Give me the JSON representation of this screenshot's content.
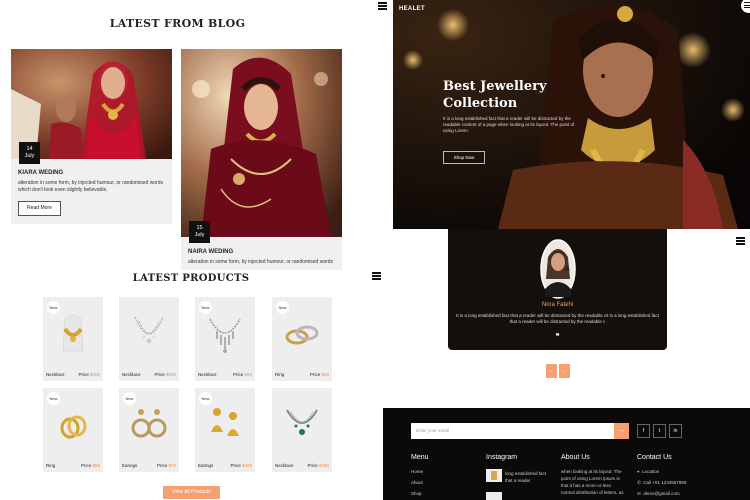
{
  "blog": {
    "title": "LATEST FROM BLOG",
    "posts": [
      {
        "day": "14",
        "month": "July",
        "title": "KIARA WEDING",
        "excerpt": "alteration in some form, by injected humour, or randomised words which don't look even slightly believable.",
        "read_more": "Read More"
      },
      {
        "day": "15",
        "month": "July",
        "title": "NAIRA WEDING",
        "excerpt": "alteration in some form, by injected humour, or randomised words"
      }
    ]
  },
  "products": {
    "title": "LATEST PRODUCTS",
    "badge": "New",
    "price_label": "Price",
    "items": [
      {
        "badge": "New",
        "name": "Necklace",
        "price": "$200",
        "icon": "gold-choker-icon"
      },
      {
        "badge": "",
        "name": "Necklace",
        "price": "$300",
        "icon": "diamond-necklace-icon"
      },
      {
        "badge": "New",
        "name": "Necklace",
        "price": "$90",
        "icon": "silver-necklace-icon"
      },
      {
        "badge": "New",
        "name": "Ring",
        "price": "$49",
        "icon": "ring-pair-icon"
      },
      {
        "badge": "New",
        "name": "Ring",
        "price": "$50",
        "icon": "gold-ring-icon"
      },
      {
        "badge": "New",
        "name": "Earings",
        "price": "$72",
        "icon": "pearl-earring-icon"
      },
      {
        "badge": "New",
        "name": "Earings",
        "price": "$480",
        "icon": "gold-jhumka-icon"
      },
      {
        "badge": "",
        "name": "Necklace",
        "price": "$490",
        "icon": "emerald-necklace-icon"
      }
    ],
    "view_all": "View All Products"
  },
  "hero": {
    "logo": "HEALET",
    "title_line1": "Best Jewellery",
    "title_line2": "Collection",
    "text": "It is a long established fact that a reader will be distracted by the readable content of a page when looking at its layout. The point of using Lorem",
    "button": "Shop Now"
  },
  "testimonial": {
    "name": "Nora Fatehi",
    "quote": "It is a long established fact that a reader will be distracted by the readable cit is a long established fact that a reader will be distracted by the readable c",
    "mark": "❝"
  },
  "slider": {
    "prev": "←",
    "next": "→"
  },
  "footer": {
    "email_placeholder": "Enter your email",
    "email_submit": "→",
    "social": [
      "f",
      "t",
      "in"
    ],
    "menu_title": "Menu",
    "menu": [
      "Home",
      "About",
      "Shop"
    ],
    "instagram_title": "Instagram",
    "instagram_text": "long established fact that a reader",
    "about_title": "About Us",
    "about_text": [
      "when looking at its layout. The",
      "point of using Lorem Ipsum is",
      "that it has a more-or-less",
      "normal distribution of letters, as"
    ],
    "contact_title": "Contact Us",
    "contact": [
      {
        "icon": "location-icon",
        "text": "Location"
      },
      {
        "icon": "phone-icon",
        "text": "Call +01 1234567890"
      },
      {
        "icon": "mail-icon",
        "text": "demo@gmail.com"
      }
    ]
  },
  "colors": {
    "accent": "#f4a071",
    "dark": "#150f0b"
  }
}
